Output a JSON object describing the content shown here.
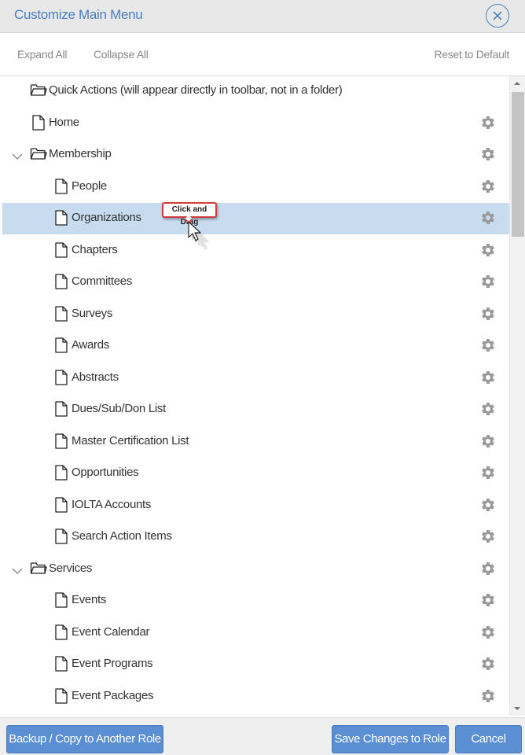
{
  "dialog": {
    "title": "Customize Main Menu",
    "close_icon": "close-circle-icon"
  },
  "toolbar": {
    "expand_all": "Expand All",
    "collapse_all": "Collapse All",
    "reset": "Reset to Default"
  },
  "tree": {
    "items": [
      {
        "label": "Quick Actions (will appear directly in toolbar, not in a folder)",
        "type": "folder",
        "level": 0,
        "expandable": false,
        "gear": false,
        "selected": false
      },
      {
        "label": "Home",
        "type": "page",
        "level": 0,
        "expandable": false,
        "gear": true,
        "selected": false
      },
      {
        "label": "Membership",
        "type": "folder",
        "level": 0,
        "expandable": true,
        "gear": true,
        "selected": false
      },
      {
        "label": "People",
        "type": "page",
        "level": 1,
        "expandable": false,
        "gear": true,
        "selected": false
      },
      {
        "label": "Organizations",
        "type": "page",
        "level": 1,
        "expandable": false,
        "gear": true,
        "selected": true
      },
      {
        "label": "Chapters",
        "type": "page",
        "level": 1,
        "expandable": false,
        "gear": true,
        "selected": false
      },
      {
        "label": "Committees",
        "type": "page",
        "level": 1,
        "expandable": false,
        "gear": true,
        "selected": false
      },
      {
        "label": "Surveys",
        "type": "page",
        "level": 1,
        "expandable": false,
        "gear": true,
        "selected": false
      },
      {
        "label": "Awards",
        "type": "page",
        "level": 1,
        "expandable": false,
        "gear": true,
        "selected": false
      },
      {
        "label": "Abstracts",
        "type": "page",
        "level": 1,
        "expandable": false,
        "gear": true,
        "selected": false
      },
      {
        "label": "Dues/Sub/Don List",
        "type": "page",
        "level": 1,
        "expandable": false,
        "gear": true,
        "selected": false
      },
      {
        "label": "Master Certification List",
        "type": "page",
        "level": 1,
        "expandable": false,
        "gear": true,
        "selected": false
      },
      {
        "label": "Opportunities",
        "type": "page",
        "level": 1,
        "expandable": false,
        "gear": true,
        "selected": false
      },
      {
        "label": "IOLTA Accounts",
        "type": "page",
        "level": 1,
        "expandable": false,
        "gear": true,
        "selected": false
      },
      {
        "label": "Search Action Items",
        "type": "page",
        "level": 1,
        "expandable": false,
        "gear": true,
        "selected": false
      },
      {
        "label": "Services",
        "type": "folder",
        "level": 0,
        "expandable": true,
        "gear": true,
        "selected": false
      },
      {
        "label": "Events",
        "type": "page",
        "level": 1,
        "expandable": false,
        "gear": true,
        "selected": false
      },
      {
        "label": "Event Calendar",
        "type": "page",
        "level": 1,
        "expandable": false,
        "gear": true,
        "selected": false
      },
      {
        "label": "Event Programs",
        "type": "page",
        "level": 1,
        "expandable": false,
        "gear": true,
        "selected": false
      },
      {
        "label": "Event Packages",
        "type": "page",
        "level": 1,
        "expandable": false,
        "gear": true,
        "selected": false
      }
    ]
  },
  "drag_hint": {
    "text": "Click and Drag"
  },
  "footer": {
    "backup": "Backup / Copy to Another Role",
    "save": "Save Changes to Role",
    "cancel": "Cancel"
  },
  "colors": {
    "accent": "#4a7fc1",
    "button": "#5b8fd3",
    "selected_row": "#c8dcf0",
    "tooltip_border": "#d23c3c"
  }
}
